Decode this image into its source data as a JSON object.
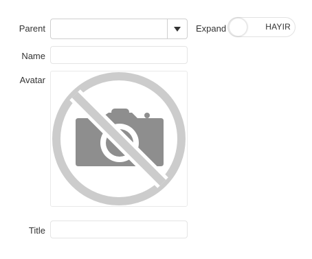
{
  "form": {
    "parent": {
      "label": "Parent",
      "value": "",
      "arrow_icon": "caret-down-icon"
    },
    "expand": {
      "label": "Expand",
      "toggle_text": "HAYIR",
      "checked": false
    },
    "name": {
      "label": "Name",
      "value": ""
    },
    "avatar": {
      "label": "Avatar",
      "placeholder_icon": "no-camera-icon",
      "colors": {
        "circle": "#cccccc",
        "camera": "#8e8e8e"
      }
    },
    "title": {
      "label": "Title",
      "value": ""
    }
  }
}
